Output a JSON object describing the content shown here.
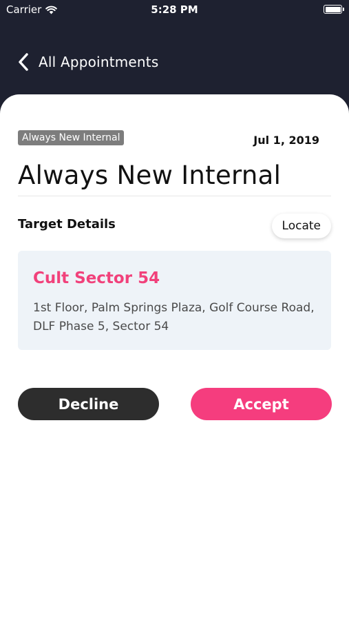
{
  "status_bar": {
    "carrier": "Carrier",
    "time": "5:28 PM",
    "wifi_icon": "wifi-icon",
    "battery_icon": "battery-icon"
  },
  "nav": {
    "back_icon": "chevron-left-icon",
    "title": "All Appointments"
  },
  "appointment": {
    "tag": "Always New Internal",
    "date": "Jul 1, 2019",
    "title": "Always New Internal"
  },
  "target": {
    "section_label": "Target Details",
    "locate_label": "Locate",
    "name": "Cult Sector 54",
    "address": "1st Floor, Palm Springs Plaza, Golf Course Road, DLF Phase 5, Sector 54"
  },
  "actions": {
    "decline_label": "Decline",
    "accept_label": "Accept"
  },
  "colors": {
    "header_bg": "#1e2130",
    "accent_pink": "#f53d7e",
    "target_name": "#f1417b",
    "decline_bg": "#2d2d2d",
    "target_box_bg": "#eef3f8",
    "tag_bg": "#7d7d7d"
  }
}
